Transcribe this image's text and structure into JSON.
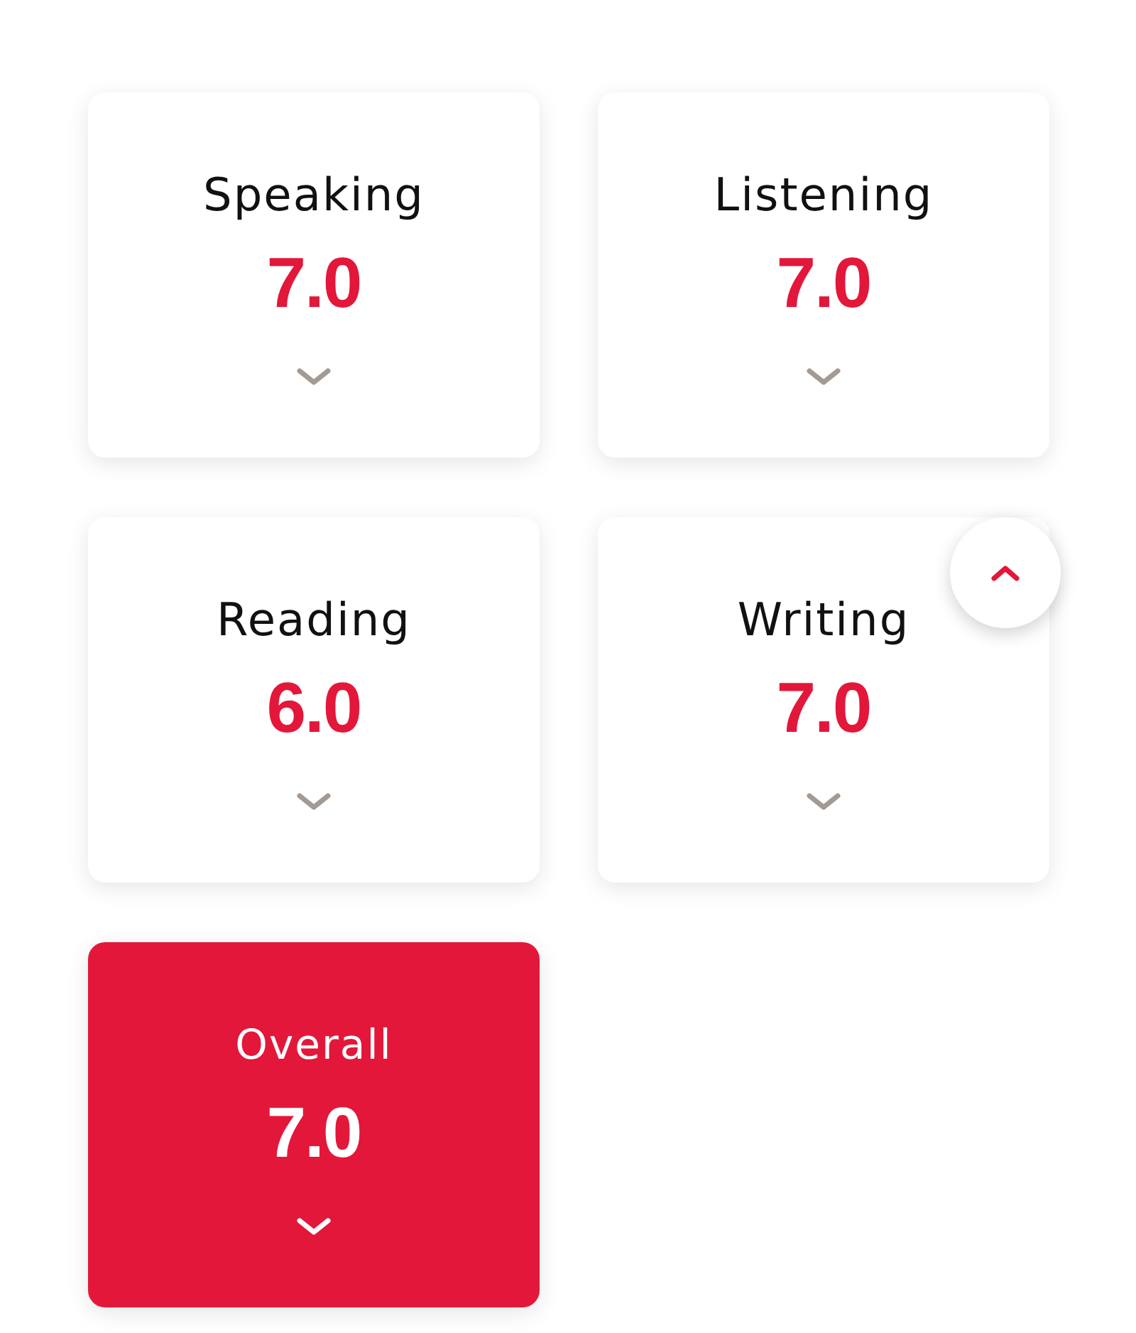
{
  "scores": [
    {
      "label": "Speaking",
      "score": "7.0",
      "highlighted": false
    },
    {
      "label": "Listening",
      "score": "7.0",
      "highlighted": false
    },
    {
      "label": "Reading",
      "score": "6.0",
      "highlighted": false
    },
    {
      "label": "Writing",
      "score": "7.0",
      "highlighted": false
    },
    {
      "label": "Overall",
      "score": "7.0",
      "highlighted": true
    }
  ],
  "scroll_to_top": {
    "visible": true
  }
}
